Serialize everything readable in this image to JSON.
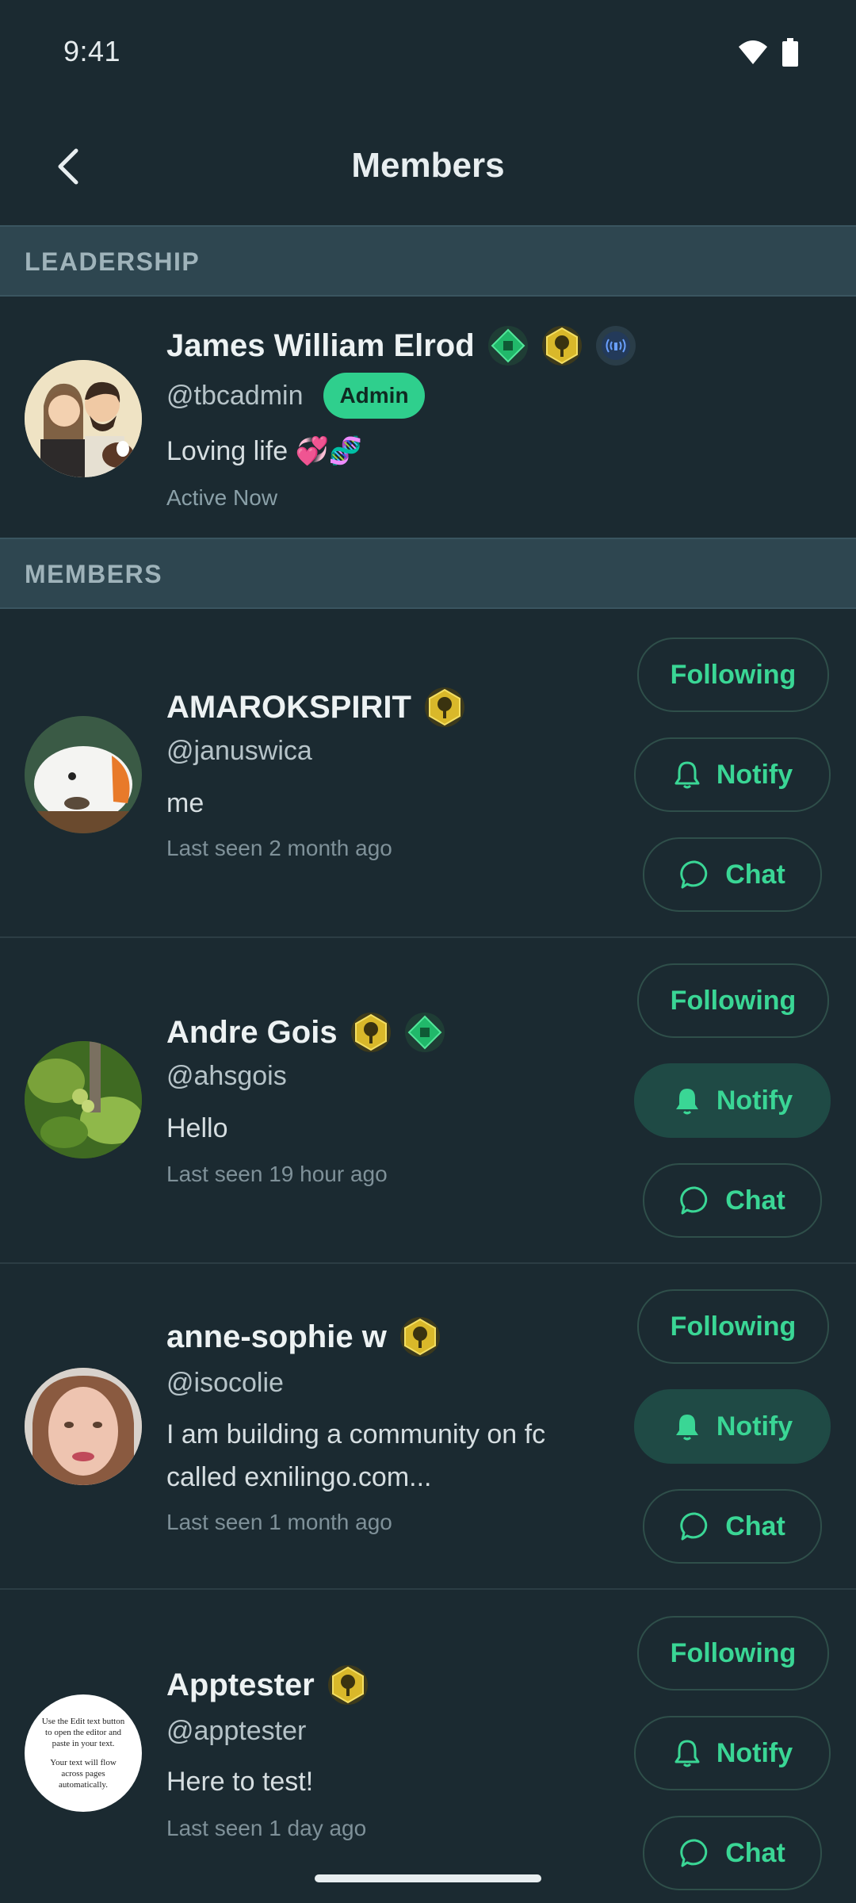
{
  "status": {
    "time": "9:41"
  },
  "header": {
    "title": "Members"
  },
  "sections": {
    "leadership": "LEADERSHIP",
    "members": "MEMBERS"
  },
  "leader": {
    "name": "James William Elrod",
    "handle": "@tbcadmin",
    "role_badge": "Admin",
    "bio": "Loving life 💞🧬",
    "status": "Active Now",
    "badges": [
      "green-diamond-badge-icon",
      "gold-tree-badge-icon",
      "blue-signal-badge-icon"
    ]
  },
  "members": [
    {
      "name": "AMAROKSPIRIT",
      "handle": "@januswica",
      "bio": "me",
      "seen": "Last seen 2 month ago",
      "badges": [
        "gold-tree-badge-icon"
      ],
      "notify_active": false
    },
    {
      "name": "Andre Gois",
      "handle": "@ahsgois",
      "bio": "Hello",
      "seen": "Last seen 19 hour ago",
      "badges": [
        "gold-tree-badge-icon",
        "green-diamond-badge-icon"
      ],
      "notify_active": true
    },
    {
      "name": "anne-sophie w",
      "handle": "@isocolie",
      "bio": "I am building a community on fc called exnilingo.com...",
      "seen": "Last seen 1 month ago",
      "badges": [
        "gold-tree-badge-icon"
      ],
      "notify_active": true
    },
    {
      "name": "Apptester",
      "handle": "@apptester",
      "bio": "Here to test!",
      "seen": "Last seen 1 day ago",
      "badges": [
        "gold-tree-badge-icon"
      ],
      "notify_active": false
    }
  ],
  "buttons": {
    "following": "Following",
    "notify": "Notify",
    "chat": "Chat"
  },
  "avatar_text": {
    "apptester_line1": "Use the Edit text button to open the editor and paste in your text.",
    "apptester_line2": "Your text will flow across pages automatically."
  },
  "colors": {
    "background": "#1b2a31",
    "accent": "#3ad695",
    "section": "#2e4650",
    "admin": "#2fcf8d"
  }
}
